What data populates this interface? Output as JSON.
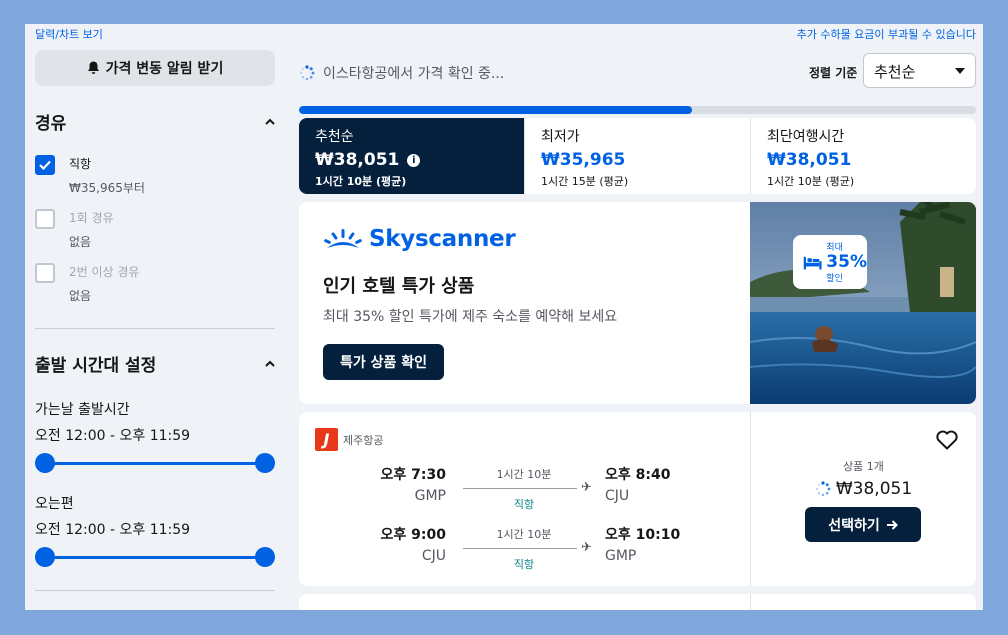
{
  "top_links": {
    "calendar": "달력/차트 보기",
    "fees_notice": "추가 수하물 요금이 부과될 수 있습니다"
  },
  "sidebar": {
    "alert_button": "가격 변동 알림 받기",
    "stops": {
      "title": "경유",
      "options": [
        {
          "label": "직항",
          "sub": "₩35,965부터",
          "checked": true
        },
        {
          "label": "1회 경유",
          "sub": "없음",
          "checked": false
        },
        {
          "label": "2번 이상 경유",
          "sub": "없음",
          "checked": false
        }
      ]
    },
    "departure_times": {
      "title": "출발 시간대 설정",
      "outbound_label": "가는날 출발시간",
      "outbound_range": "오전 12:00 - 오후 11:59",
      "return_label": "오는편",
      "return_range": "오전 12:00 - 오후 11:59"
    }
  },
  "main": {
    "status": "이스타항공에서 가격 확인 중...",
    "sort_label": "정렬 기준",
    "sort_value": "추천순",
    "progress": 0.58,
    "tabs": [
      {
        "name": "추천순",
        "price": "₩38,051",
        "duration": "1시간 10분 (평균)",
        "active": true
      },
      {
        "name": "최저가",
        "price": "₩35,965",
        "duration": "1시간 15분 (평균)",
        "active": false
      },
      {
        "name": "최단여행시간",
        "price": "₩38,051",
        "duration": "1시간 10분 (평균)",
        "active": false
      }
    ],
    "promo": {
      "brand": "Skyscanner",
      "title": "인기 호텔 특가 상품",
      "subtitle": "최대 35% 할인 특가에 제주 숙소를 예약해 보세요",
      "button": "특가 상품 확인",
      "badge_top": "최대",
      "badge_pct": "35%",
      "badge_bottom": "할인"
    },
    "flight": {
      "airline": "제주항공",
      "legs": [
        {
          "dep_time": "오후 7:30",
          "dep_code": "GMP",
          "duration": "1시간 10분",
          "stops": "직항",
          "arr_time": "오후 8:40",
          "arr_code": "CJU"
        },
        {
          "dep_time": "오후 9:00",
          "dep_code": "CJU",
          "duration": "1시간 10분",
          "stops": "직항",
          "arr_time": "오후 10:10",
          "arr_code": "GMP"
        }
      ],
      "deals": "상품 1개",
      "price": "₩38,051",
      "select": "선택하기"
    }
  },
  "colors": {
    "accent": "#0062e3",
    "navy": "#05203c",
    "direct": "#0c838a",
    "airline": "#e8381a"
  }
}
